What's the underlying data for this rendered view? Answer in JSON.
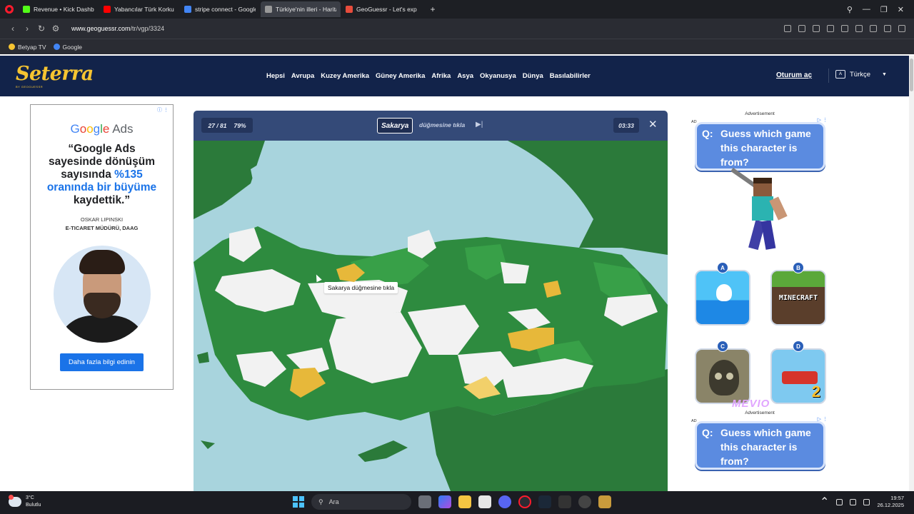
{
  "browser": {
    "tabs": [
      {
        "title": "Revenue • Kick Dashboard",
        "color": "#53fc18",
        "active": false
      },
      {
        "title": "Yabancılar Türk Korku Filmi",
        "color": "#ff0000",
        "active": false
      },
      {
        "title": "stripe connect - Google'da",
        "color": "#4285f4",
        "active": false
      },
      {
        "title": "Türkiye'nin illeri - Harita T",
        "color": "#999999",
        "active": true
      },
      {
        "title": "GeoGuessr - Let's expl",
        "color": "#e74c3c",
        "active": false
      }
    ],
    "url_host": "www.geoguessr.com",
    "url_path": "/tr/vgp/3324",
    "bookmarks": [
      {
        "label": "Betyap TV",
        "color": "#f6c431"
      },
      {
        "label": "Google",
        "color": "#4285f4"
      }
    ]
  },
  "site": {
    "logo": "Seterra",
    "logo_sub": "BY GEOGUESSR",
    "nav": [
      "Hepsi",
      "Avrupa",
      "Kuzey Amerika",
      "Güney Amerika",
      "Afrika",
      "Asya",
      "Okyanusya",
      "Dünya",
      "Basılabilirler"
    ],
    "login": "Oturum aç",
    "language": "Türkçe",
    "language_icon": "translate-icon"
  },
  "left_ad": {
    "brand_google": "Google",
    "brand_ads": "Ads",
    "quote_line1": "“Google Ads",
    "quote_line2": "sayesinde dönüşüm",
    "quote_line3_a": "sayısında ",
    "quote_line3_b": "%135",
    "quote_line4": "oranında bir büyüme",
    "quote_line5": "kaydettik.”",
    "author_name": "OSKAR LIPINSKI",
    "author_title": "E-TICARET MÜDÜRÜ, DAAG",
    "cta": "Daha fazla bilgi edinin"
  },
  "game": {
    "progress": "27 / 81",
    "percent": "79%",
    "target": "Sakarya",
    "prompt": "düğmesine tıkla",
    "timer": "03:33",
    "tooltip": "Sakarya düğmesine tıkla",
    "colors": {
      "sea": "#a8d4dd",
      "correct_dark": "#2e8b3f",
      "correct_light": "#38a048",
      "wrong": "#e7b83a",
      "unanswered": "#f2f2f2",
      "neighbor": "#2b7a3a"
    }
  },
  "right_ads": [
    {
      "label": "Advertisement",
      "mark": "AD",
      "question_q": "Q:",
      "question": "Guess which game this character is from?",
      "options": [
        {
          "letter": "A"
        },
        {
          "letter": "B",
          "text": "MINECRAFT"
        },
        {
          "letter": "C"
        },
        {
          "letter": "D",
          "text": "2"
        }
      ],
      "brand": "MEVIO"
    },
    {
      "label": "Advertisement",
      "mark": "AD",
      "question_q": "Q:",
      "question": "Guess which game this character is from?"
    }
  ],
  "taskbar": {
    "temp": "3°C",
    "weather": "Bulutlu",
    "search": "Ara",
    "time": "19:57",
    "date": "26.12.2025"
  }
}
